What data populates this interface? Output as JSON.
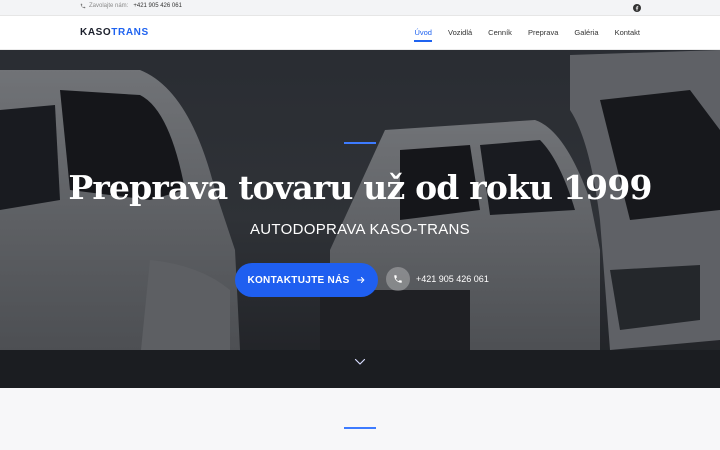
{
  "topbar": {
    "call_label": "Zavolajte nám:",
    "phone": "+421 905 426 061",
    "phone_icon": "phone-icon",
    "social_icon": "facebook-icon"
  },
  "nav": {
    "logo_part1": "KASO",
    "logo_part2": "TRANS",
    "items": [
      {
        "label": "Úvod",
        "active": true
      },
      {
        "label": "Vozidlá",
        "active": false
      },
      {
        "label": "Cenník",
        "active": false
      },
      {
        "label": "Preprava",
        "active": false
      },
      {
        "label": "Galéria",
        "active": false
      },
      {
        "label": "Kontakt",
        "active": false
      }
    ]
  },
  "hero": {
    "title": "Preprava tovaru už od roku 1999",
    "subtitle": "AUTODOPRAVA KASO-TRANS",
    "cta_label": "KONTAKTUJTE NÁS",
    "cta_icon": "arrow-right-icon",
    "phone_icon": "phone-icon",
    "phone": "+421 905 426 061",
    "scroll_icon": "chevron-down-icon"
  },
  "colors": {
    "accent": "#1f5ff0",
    "logo_dark": "#1b1f2b",
    "section_bg": "#f7f7f9"
  }
}
